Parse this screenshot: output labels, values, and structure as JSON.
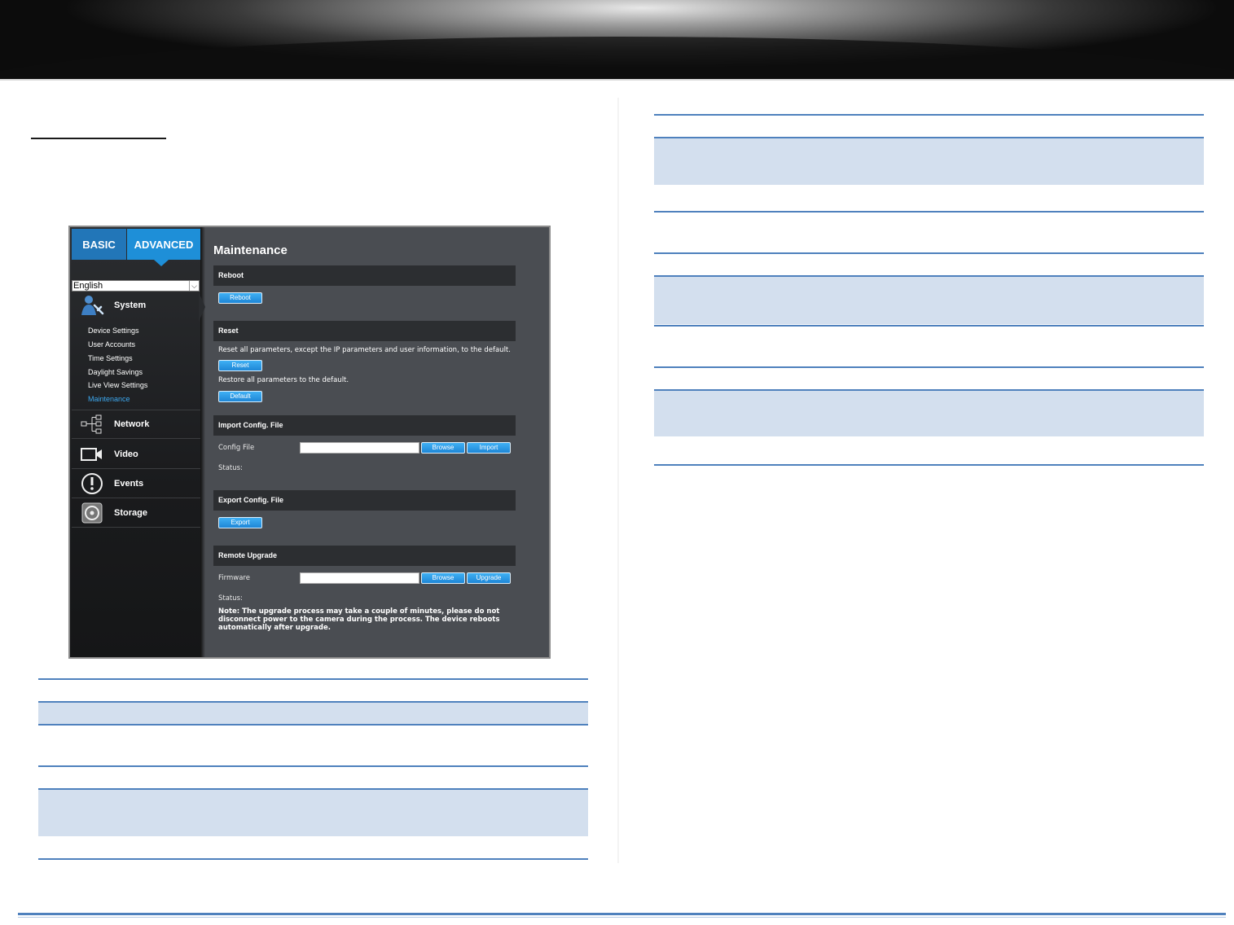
{
  "app": {
    "tabs": {
      "basic": "BASIC",
      "advanced": "ADVANCED"
    },
    "language": {
      "selected": "English"
    },
    "menu": {
      "system": "System",
      "system_items": [
        "Device Settings",
        "User Accounts",
        "Time Settings",
        "Daylight Savings",
        "Live View Settings",
        "Maintenance"
      ],
      "active_item": "Maintenance",
      "network": "Network",
      "video": "Video",
      "events": "Events",
      "storage": "Storage"
    },
    "page_title": "Maintenance",
    "reboot": {
      "header": "Reboot",
      "button": "Reboot"
    },
    "reset": {
      "header": "Reset",
      "reset_text": "Reset all parameters, except the IP parameters and user information, to the default.",
      "reset_button": "Reset",
      "default_text": "Restore all parameters to the default.",
      "default_button": "Default"
    },
    "import_config": {
      "header": "Import Config. File",
      "field_label": "Config File",
      "field_value": "",
      "browse_button": "Browse",
      "import_button": "Import",
      "status_label": "Status:"
    },
    "export_config": {
      "header": "Export Config. File",
      "button": "Export"
    },
    "remote_upgrade": {
      "header": "Remote Upgrade",
      "field_label": "Firmware",
      "field_value": "",
      "browse_button": "Browse",
      "upgrade_button": "Upgrade",
      "status_label": "Status:",
      "note": "Note: The upgrade process may take a couple of minutes, please do not disconnect power to the camera during the process. The device reboots automatically after upgrade."
    }
  },
  "colors": {
    "accent": "#1e8fd8",
    "table_rule": "#4f81bd",
    "table_shade": "#d3dfee",
    "panel_bg": "#4a4d52",
    "sidebar_bg": "#1a1b1d"
  },
  "icons": [
    "user-settings-icon",
    "network-tree-icon",
    "video-camera-icon",
    "alert-icon",
    "storage-disk-icon",
    "dropdown-arrow-icon"
  ]
}
